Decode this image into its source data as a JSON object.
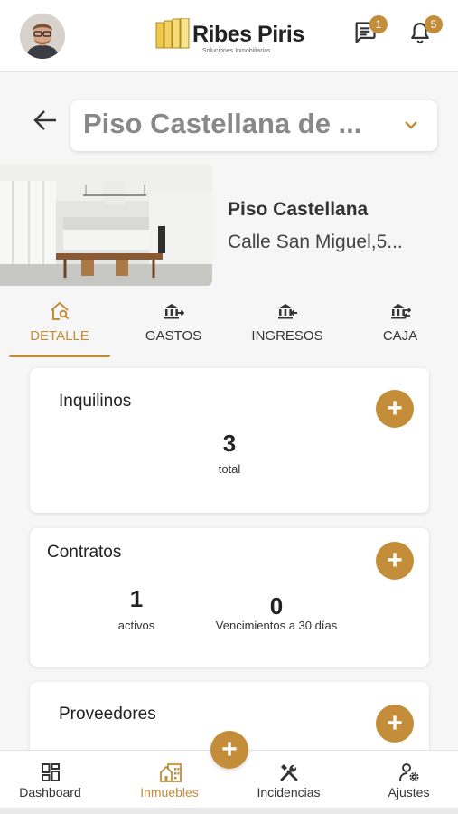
{
  "header": {
    "logo_name": "Ribes Piris",
    "logo_tagline": "Soluciones Inmobiliarias",
    "messages_badge": "1",
    "notifications_badge": "5"
  },
  "property_selector": {
    "value": "Piso Castellana de ..."
  },
  "property": {
    "name": "Piso Castellana",
    "address": "Calle San Miguel,5..."
  },
  "tabs": [
    {
      "label": "DETALLE",
      "icon": "house-search-icon",
      "active": true
    },
    {
      "label": "GASTOS",
      "icon": "bank-out-icon",
      "active": false
    },
    {
      "label": "INGRESOS",
      "icon": "bank-in-icon",
      "active": false
    },
    {
      "label": "CAJA",
      "icon": "bank-transfer-icon",
      "active": false
    }
  ],
  "cards": {
    "inquilinos": {
      "title": "Inquilinos",
      "add_label": "+",
      "stats": [
        {
          "value": "3",
          "label": "total"
        }
      ]
    },
    "contratos": {
      "title": "Contratos",
      "add_label": "+",
      "stats": [
        {
          "value": "1",
          "label": "activos"
        },
        {
          "value": "0",
          "label": "Vencimientos a 30 días"
        }
      ]
    },
    "proveedores": {
      "title": "Proveedores",
      "add_label": "+"
    }
  },
  "fab_label": "+",
  "bottom_nav": [
    {
      "label": "Dashboard",
      "icon": "dashboard-icon",
      "active": false
    },
    {
      "label": "Inmuebles",
      "icon": "building-icon",
      "active": true
    },
    {
      "label": "Incidencias",
      "icon": "tools-icon",
      "active": false
    },
    {
      "label": "Ajustes",
      "icon": "user-settings-icon",
      "active": false
    }
  ],
  "colors": {
    "accent": "#c38d3a",
    "text": "#333333",
    "muted": "#888888",
    "background": "#f6f6f6"
  }
}
